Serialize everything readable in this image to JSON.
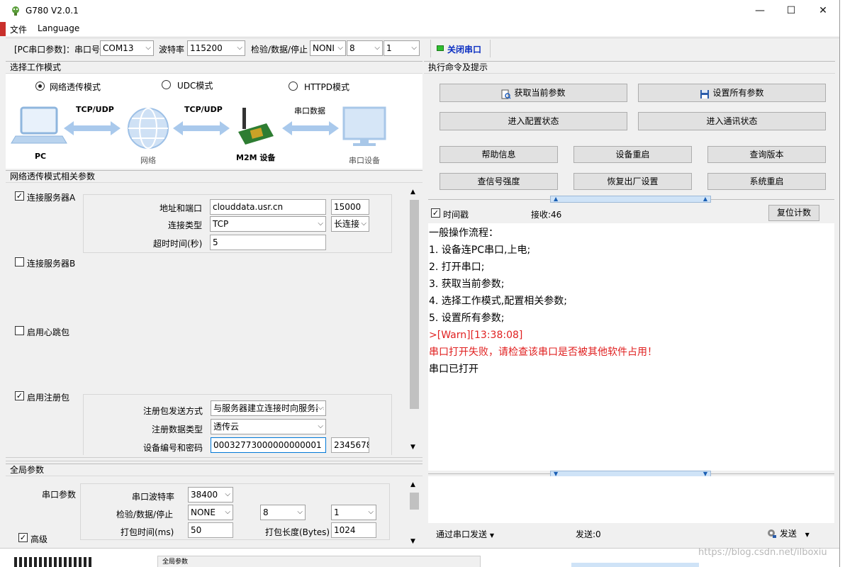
{
  "window": {
    "title": "G780 V2.0.1",
    "minimize": "—",
    "maximize": "☐",
    "close": "✕"
  },
  "menu": [
    "文件",
    "Language"
  ],
  "toolbar": {
    "serial_label": "[PC串口参数]：串口号",
    "port": "COM13",
    "baud_label": "波特率",
    "baud": "115200",
    "check_label": "检验/数据/停止",
    "parity": "NONI",
    "data_bits": "8",
    "stop_bits": "1",
    "close_port": "关闭串口"
  },
  "mode": {
    "header": "选择工作模式",
    "options": [
      "网络透传模式",
      "UDC模式",
      "HTTPD模式"
    ],
    "selected": 0,
    "diagram": {
      "pc": "PC",
      "net": "网络",
      "m2m": "M2M 设备",
      "serial_dev": "串口设备",
      "link1": "TCP/UDP",
      "link2": "TCP/UDP",
      "link3": "串口数据"
    }
  },
  "params": {
    "header": "网络透传模式相关参数",
    "server_a": {
      "label": "连接服务器A",
      "checked": true,
      "addr_label": "地址和端口",
      "addr": "clouddata.usr.cn",
      "port": "15000",
      "type_label": "连接类型",
      "type": "TCP",
      "conn": "长连接",
      "timeout_label": "超时时间(秒)",
      "timeout": "5"
    },
    "server_b": {
      "label": "连接服务器B",
      "checked": false
    },
    "heartbeat": {
      "label": "启用心跳包",
      "checked": false
    },
    "register": {
      "label": "启用注册包",
      "checked": true,
      "send_label": "注册包发送方式",
      "send": "与服务器建立连接时向服务器",
      "dtype_label": "注册数据类型",
      "dtype": "透传云",
      "id_label": "设备编号和密码",
      "id": "00032773000000000001",
      "pwd": "2345678"
    }
  },
  "global": {
    "header": "全局参数",
    "serial_label": "串口参数",
    "baud_label": "串口波特率",
    "baud": "38400",
    "check_label": "检验/数据/停止",
    "parity": "NONE",
    "data_bits": "8",
    "stop_bits": "1",
    "pack_time_label": "打包时间(ms)",
    "pack_time": "50",
    "pack_len_label": "打包长度(Bytes)",
    "pack_len": "1024",
    "advanced": "高级"
  },
  "cmd": {
    "header": "执行命令及提示",
    "get_params": "获取当前参数",
    "set_params": "设置所有参数",
    "enter_config": "进入配置状态",
    "enter_comm": "进入通讯状态",
    "help": "帮助信息",
    "reboot_dev": "设备重启",
    "query_ver": "查询版本",
    "signal": "查信号强度",
    "factory": "恢复出厂设置",
    "sys_reboot": "系统重启"
  },
  "log": {
    "timestamp_label": "时间戳",
    "rx_label": "接收:46",
    "reset": "复位计数",
    "lines": [
      "一般操作流程：",
      "1. 设备连PC串口,上电;",
      "2. 打开串口;",
      "3. 获取当前参数;",
      "4. 选择工作模式,配置相关参数;",
      "5. 设置所有参数;"
    ],
    "warn": ">[Warn][13:38:08]",
    "error": "串口打开失败，请检查该串口是否被其他软件占用！",
    "opened": "串口已打开"
  },
  "send": {
    "via": "通过串口发送",
    "tx": "发送:0",
    "send_btn": "发送"
  },
  "watermark": "https://blog.csdn.net/ilboxiu",
  "bg_bottom": "全局参数"
}
